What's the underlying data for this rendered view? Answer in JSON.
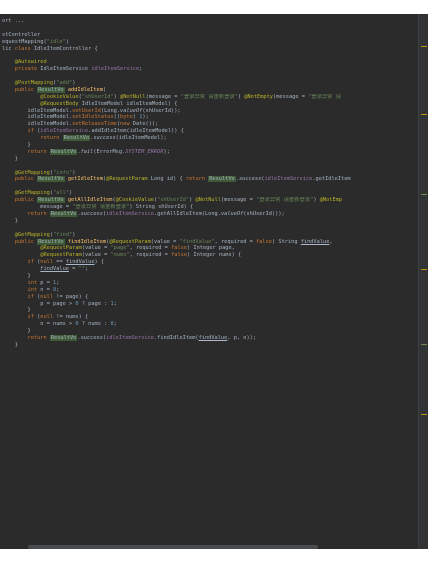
{
  "code_lines": [
    "ort ...",
    "",
    "stController",
    "equestMapping(\"idle\")",
    "lic class IdleItemController {",
    "",
    "    @Autowired",
    "    private IdleItemService idleItemService;",
    "",
    "    @PostMapping(\"add\")",
    "    public ResultVo addIdleItem(",
    "            @CookieValue(\"shUserId\") @NotNull(message = \"登录异常 请重新登录\") @NotEmpty(message = \"登录异常 请",
    "            @RequestBody IdleItemModel idleItemModel) {",
    "        idleItemModel.setUserId(Long.valueOf(shUserId));",
    "        idleItemModel.setIdleStatus((byte) 1);",
    "        idleItemModel.setReleaseTime(new Date());",
    "        if (idleItemService.addIdleItem(idleItemModel)) {",
    "            return ResultVo.success(idleItemModel);",
    "        }",
    "        return ResultVo.fail(ErrorMsg.SYSTEM_ERROR);",
    "    }",
    "",
    "    @GetMapping(\"info\")",
    "    public ResultVo getIdleItem(@RequestParam Long id) { return ResultVo.success(idleItemService.getIdleItem",
    "",
    "    @GetMapping(\"all\")",
    "    public ResultVo getAllIdleItem(@CookieValue(\"shUserId\") @NotNull(message = \"登录异常 请重新登录\") @NotEmp",
    "            message = \"登录异常 请重新登录\") String shUserId) {",
    "        return ResultVo.success(idleItemService.getAllIdleItem(Long.valueOf(shUserId)));",
    "    }",
    "",
    "    @GetMapping(\"find\")",
    "    public ResultVo findIdleItem(@RequestParam(value = \"findValue\", required = false) String findValue,",
    "            @RequestParam(value = \"page\", required = false) Integer page,",
    "            @RequestParam(value = \"nums\", required = false) Integer nums) {",
    "        if (null == findValue) {",
    "            findValue = \"\";",
    "        }",
    "        int p = 1;",
    "        int n = 8;",
    "        if (null != page) {",
    "            p = page > 0 ? page : 1;",
    "        }",
    "        if (null != nums) {",
    "            n = nums > 0 ? nums : 8;",
    "        }",
    "        return ResultVo.success(idleItemService.findIdleItem(findValue, p, n));",
    "    }"
  ],
  "colors": {
    "background": "#2b2b2b",
    "keyword": "#cc7832",
    "annotation": "#bbb529",
    "string": "#6a8759",
    "method": "#ffc66d",
    "field": "#9876aa",
    "number": "#6897bb",
    "text": "#a9b7c6"
  }
}
